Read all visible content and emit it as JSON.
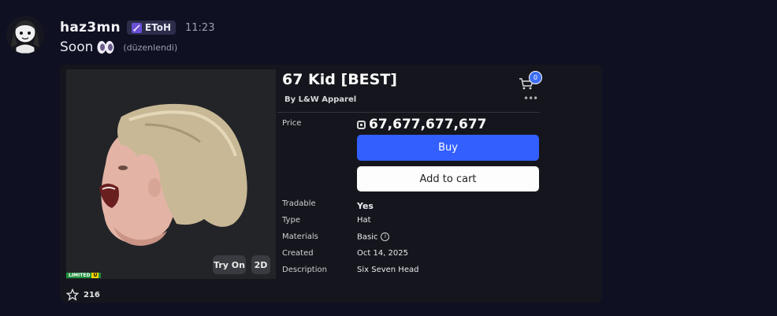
{
  "message": {
    "username": "haz3mn",
    "role_tag": "EToH",
    "timestamp": "11:23",
    "text": "Soon",
    "edited_label": "(düzenlendi)"
  },
  "item": {
    "title": "67 Kid [BEST]",
    "byline": "By L&W Apparel",
    "cart_count": "0",
    "price_label": "Price",
    "price": "67,677,677,677",
    "buy_label": "Buy",
    "add_to_cart_label": "Add to cart",
    "try_on_label": "Try On",
    "view_2d_label": "2D",
    "limited_label": "LIMITED",
    "limited_u_label": "U",
    "favorites": "216",
    "details": [
      {
        "label": "Tradable",
        "value": "Yes"
      },
      {
        "label": "Type",
        "value": "Hat"
      },
      {
        "label": "Materials",
        "value": "Basic"
      },
      {
        "label": "Created",
        "value": "Oct 14, 2025"
      },
      {
        "label": "Description",
        "value": "Six Seven Head"
      }
    ]
  },
  "colors": {
    "page_bg": "#0f1022",
    "embed_bg": "#15161d",
    "buy_button": "#335fff",
    "cart_badge": "#3d6ef2",
    "limited_green": "#1e8f3b",
    "limited_yellow": "#ffd400"
  },
  "icons": {
    "role": "sword-icon",
    "reaction": "eyes-emoji-icon",
    "cart": "cart-icon",
    "more": "more-icon",
    "currency": "robux-icon",
    "info": "info-icon",
    "favorite": "star-icon"
  }
}
